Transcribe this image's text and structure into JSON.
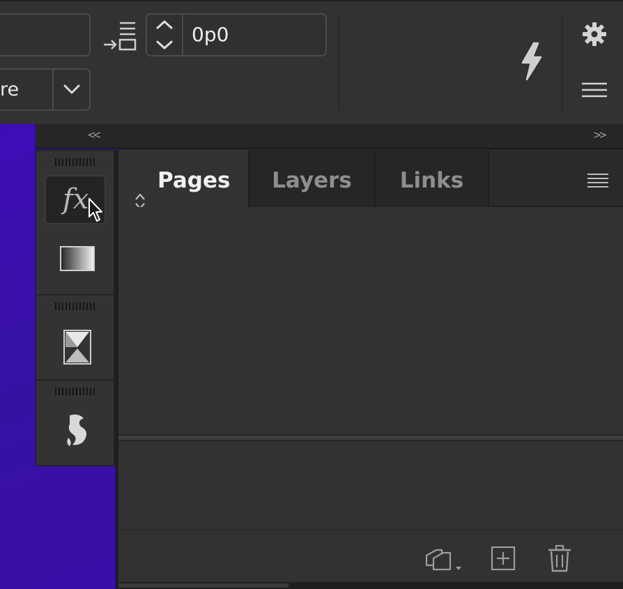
{
  "control_bar": {
    "font_family_value": "re",
    "spacing_value": "0p0"
  },
  "dock": {
    "collapse_left": "<<",
    "collapse_right": ">>"
  },
  "panel": {
    "tabs": [
      {
        "label": "Pages"
      },
      {
        "label": "Layers"
      },
      {
        "label": "Links"
      }
    ]
  },
  "icons": {
    "effects": "fx-icon",
    "gradient": "gradient-swatch-icon",
    "links": "hourglass-links-icon",
    "script": "script-icon",
    "settings": "gear-icon",
    "panel_menu": "hamburger-icon",
    "quick_actions": "lightning-icon",
    "edit_page_size": "page-size-icon",
    "new_page": "new-page-icon",
    "delete": "trash-icon"
  },
  "colors": {
    "canvas_accent": "#3f0db8",
    "panel_bg": "#323232",
    "active_tab_text": "#f2f2f2",
    "inactive_tab_text": "#8e8e8e"
  }
}
